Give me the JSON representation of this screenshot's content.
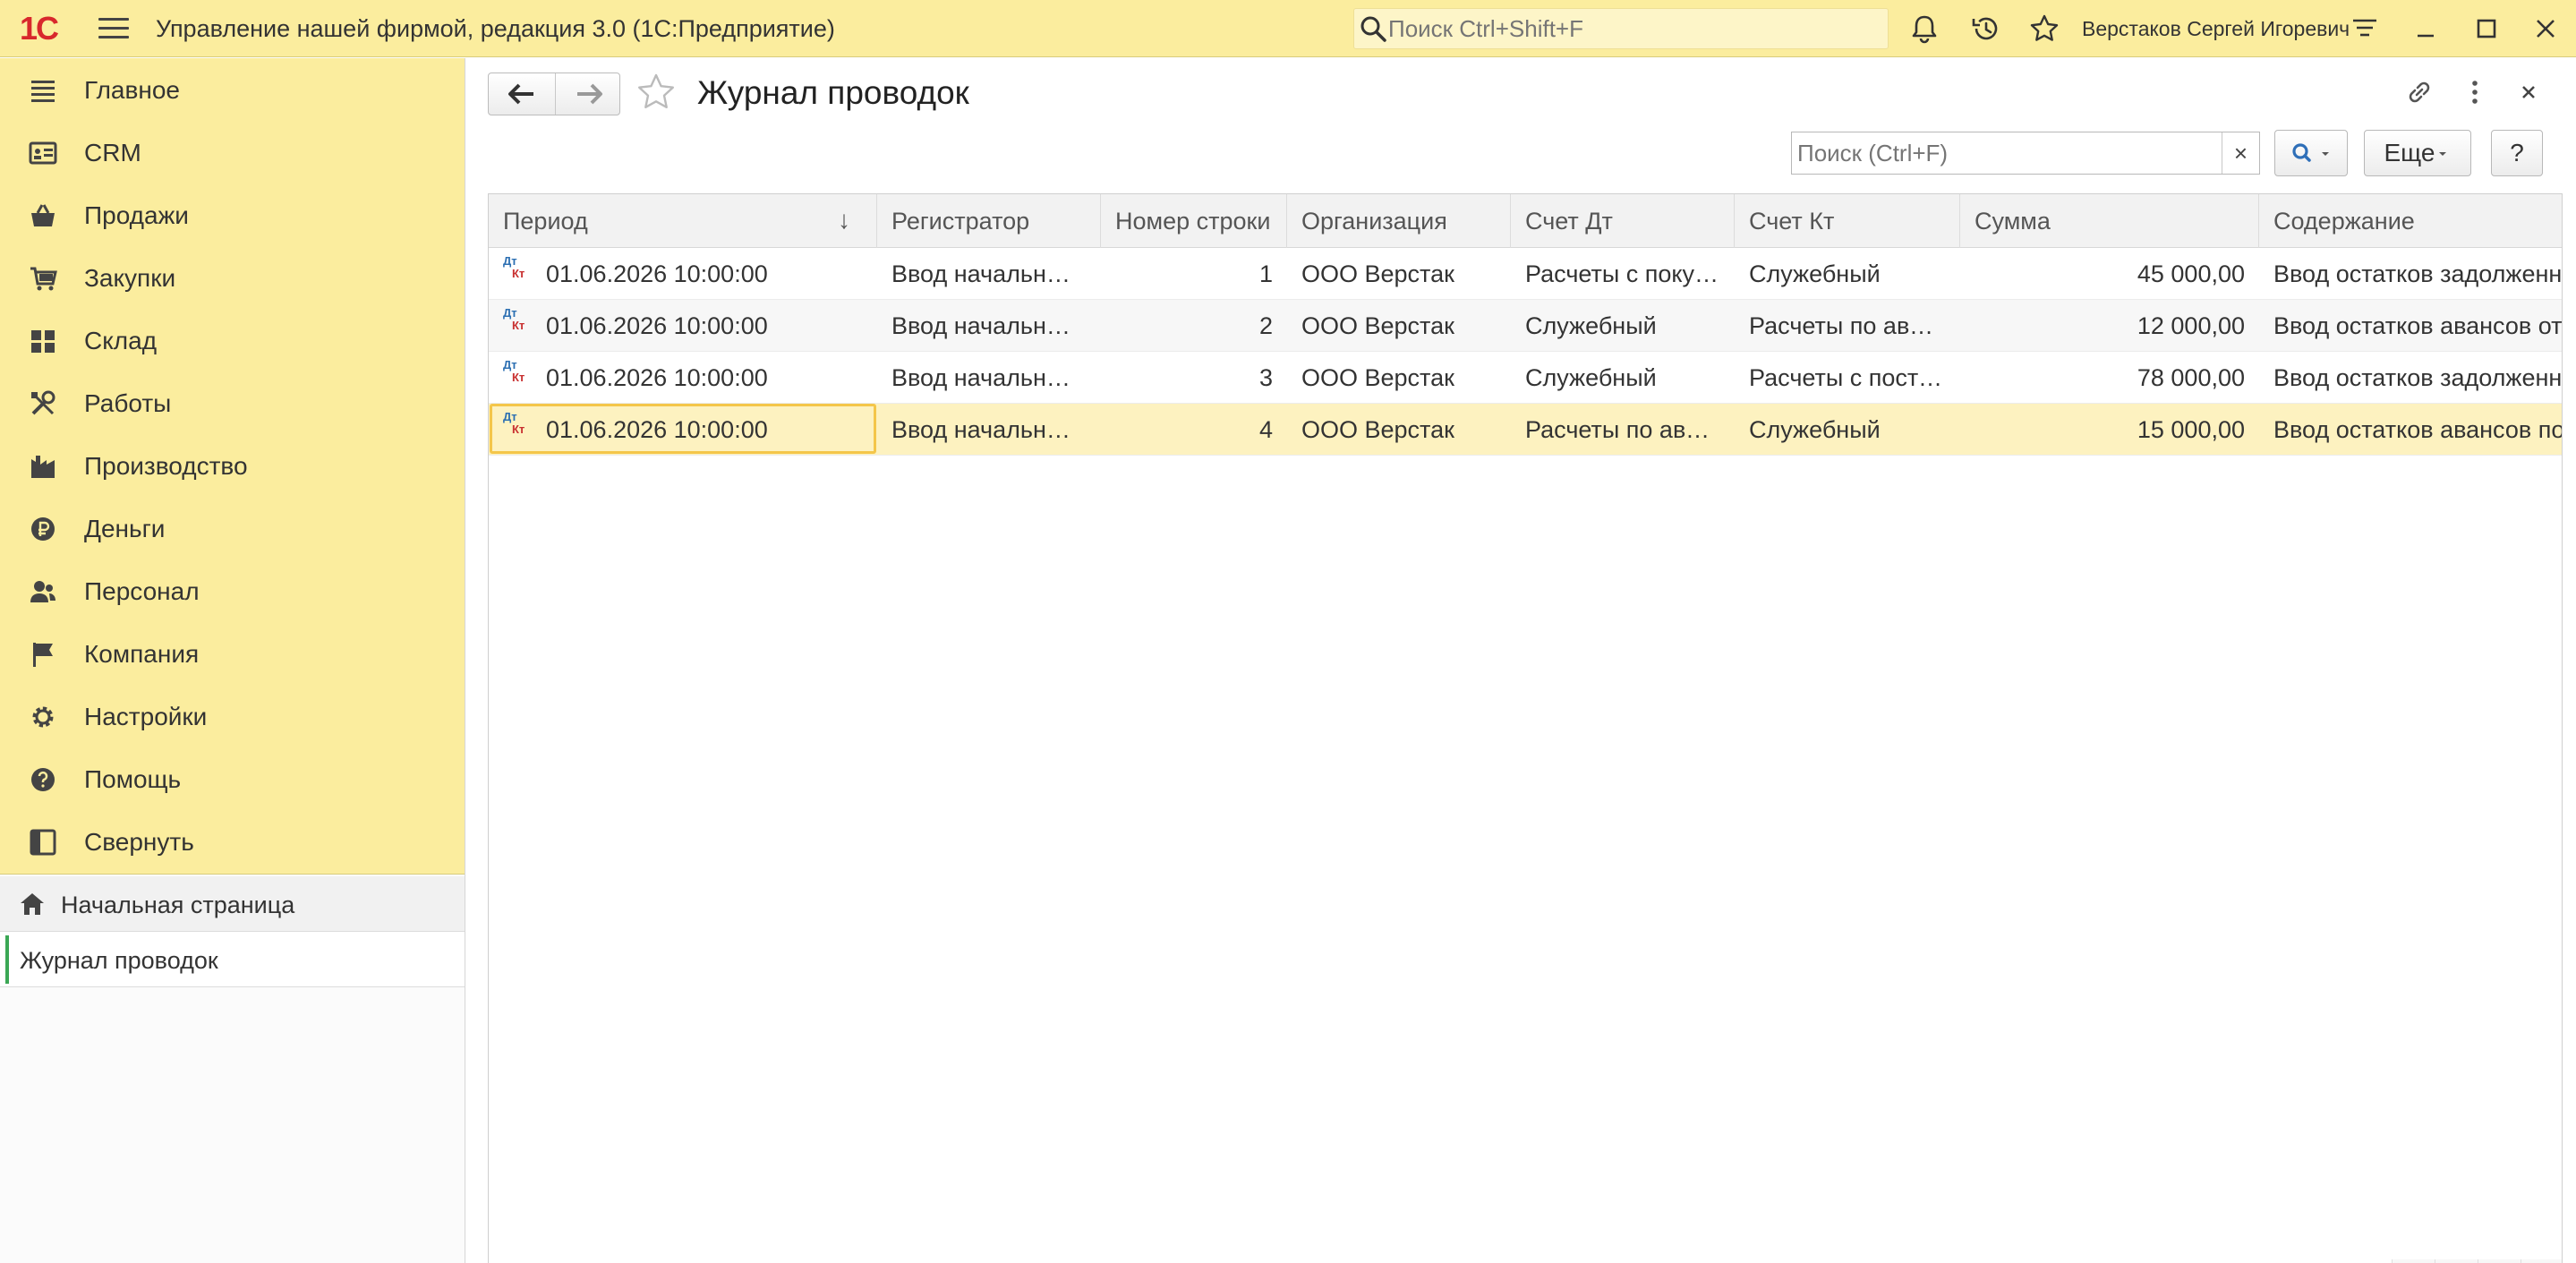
{
  "app": {
    "logo": "1С",
    "title": "Управление нашей фирмой, редакция 3.0  (1С:Предприятие)",
    "search_placeholder": "Поиск Ctrl+Shift+F",
    "user": "Верстаков Сергей Игоревич"
  },
  "sidebar": {
    "items": [
      {
        "label": "Главное",
        "icon": "home-lines-icon"
      },
      {
        "label": "CRM",
        "icon": "crm-icon"
      },
      {
        "label": "Продажи",
        "icon": "basket-icon"
      },
      {
        "label": "Закупки",
        "icon": "cart-icon"
      },
      {
        "label": "Склад",
        "icon": "warehouse-icon"
      },
      {
        "label": "Работы",
        "icon": "tools-icon"
      },
      {
        "label": "Производство",
        "icon": "factory-icon"
      },
      {
        "label": "Деньги",
        "icon": "ruble-icon"
      },
      {
        "label": "Персонал",
        "icon": "people-icon"
      },
      {
        "label": "Компания",
        "icon": "flag-icon"
      },
      {
        "label": "Настройки",
        "icon": "gear-icon"
      },
      {
        "label": "Помощь",
        "icon": "help-icon"
      },
      {
        "label": "Свернуть",
        "icon": "collapse-icon"
      }
    ],
    "open_windows": {
      "home": "Начальная страница",
      "current": "Журнал проводок"
    }
  },
  "form": {
    "title": "Журнал проводок",
    "search_placeholder": "Поиск (Ctrl+F)",
    "clear": "×",
    "more": "Еще",
    "help": "?"
  },
  "table": {
    "columns": [
      "Период",
      "Регистратор",
      "Номер строки",
      "Организация",
      "Счет Дт",
      "Счет Кт",
      "Сумма",
      "Содержание"
    ],
    "sort_indicator": "↓",
    "record_marker": {
      "dt": "Дт",
      "kt": "Кт"
    },
    "rows": [
      {
        "period": "01.06.2026 10:00:00",
        "registrator": "Ввод начальных остатков",
        "line": "1",
        "org": "ООО Верстак",
        "dt": "Расчеты с покупателями",
        "kt": "Служебный",
        "sum": "45 000,00",
        "content": "Ввод остатков задолженности"
      },
      {
        "period": "01.06.2026 10:00:00",
        "registrator": "Ввод начальных остатков",
        "line": "2",
        "org": "ООО Верстак",
        "dt": "Служебный",
        "kt": "Расчеты по авансам",
        "sum": "12 000,00",
        "content": "Ввод остатков авансов от"
      },
      {
        "period": "01.06.2026 10:00:00",
        "registrator": "Ввод начальных остатков",
        "line": "3",
        "org": "ООО Верстак",
        "dt": "Служебный",
        "kt": "Расчеты с поставщиками",
        "sum": "78 000,00",
        "content": "Ввод остатков задолженности"
      },
      {
        "period": "01.06.2026 10:00:00",
        "registrator": "Ввод начальных остатков",
        "line": "4",
        "org": "ООО Верстак",
        "dt": "Расчеты по авансам",
        "kt": "Служебный",
        "sum": "15 000,00",
        "content": "Ввод остатков авансов по"
      }
    ],
    "selected_row": 4
  },
  "colors": {
    "accent_yellow": "#fbed9e",
    "selection": "#fdf2c0",
    "focus": "#f4c64a",
    "active_tab": "#3ba755",
    "logo_red": "#d8282c"
  }
}
